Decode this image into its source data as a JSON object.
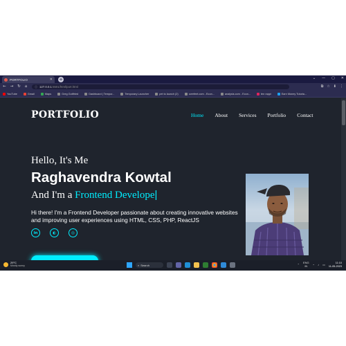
{
  "browser": {
    "tab_title": "PORTFOLIO",
    "tab_close": "✕",
    "new_tab": "+",
    "window_controls": [
      "⌄",
      "—",
      "▢",
      "✕"
    ],
    "nav_icons": [
      "←",
      "→",
      "↻",
      "⌂"
    ],
    "url_host": "127.0.0.1",
    "url_path": ":5501/html/port.html",
    "toolbar_icons": [
      "⧉",
      "☆",
      "⬇",
      "⋮"
    ]
  },
  "bookmarks": [
    {
      "label": "YouTube",
      "color": "#ff0000"
    },
    {
      "label": "Gmail",
      "color": "#ea4335"
    },
    {
      "label": "Maps",
      "color": "#34a853"
    },
    {
      "label": "Greg Gottfried",
      "color": "#8a8a8a"
    },
    {
      "label": "Dashboard | Tempor...",
      "color": "#8a8a8a"
    },
    {
      "label": "Temporary Launcher",
      "color": "#8a8a8a"
    },
    {
      "label": "pet to launch (2)",
      "color": "#8a8a8a"
    },
    {
      "label": "overfeet.com - Econ...",
      "color": "#8a8a8a"
    },
    {
      "label": "analysis.com - Econ...",
      "color": "#8a8a8a"
    },
    {
      "label": "ten rappi",
      "color": "#e0245e"
    },
    {
      "label": "Earn Money Tutoria...",
      "color": "#1da1f2"
    }
  ],
  "page": {
    "logo": "PORTFOLIO",
    "nav": [
      {
        "label": "Home",
        "active": true
      },
      {
        "label": "About",
        "active": false
      },
      {
        "label": "Services",
        "active": false
      },
      {
        "label": "Portfolio",
        "active": false
      },
      {
        "label": "Contact",
        "active": false
      }
    ],
    "greeting": "Hello, It's Me",
    "name": "Raghavendra Kowtal",
    "role_prefix": "And I'm a ",
    "role_highlight": "Frontend Develope",
    "role_cursor": "|",
    "description": "Hi there! I'm a Frontend Developer passionate about creating innovative websites and improving user experiences using HTML, CSS, PHP, ReactJS",
    "social_icons": [
      {
        "name": "linkedin",
        "glyph": "in"
      },
      {
        "name": "github",
        "glyph": "◐"
      },
      {
        "name": "instagram",
        "glyph": "◎"
      }
    ],
    "accent_color": "#00eeff",
    "background_color": "#1f242d"
  },
  "taskbar": {
    "weather_temp": "29°C",
    "weather_desc": "Mostly sunny",
    "search_label": "Search",
    "lang": "ENG",
    "lang_sub": "IN",
    "time": "11:10",
    "date": "11-05-2023",
    "tray_icons": [
      "⌃",
      "◔",
      "♪",
      "▭"
    ]
  }
}
